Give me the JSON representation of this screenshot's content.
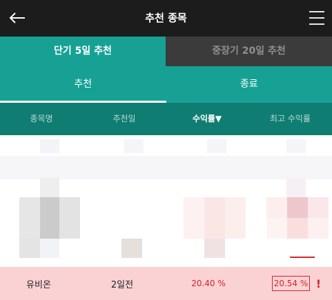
{
  "header": {
    "title": "추천 종목",
    "back_icon": "arrow-left-icon",
    "menu_icon": "hamburger-menu-icon"
  },
  "term_tabs": [
    {
      "label": "단기 5일 추천",
      "active": true
    },
    {
      "label": "중장기 20일 추천",
      "active": false
    }
  ],
  "status_tabs": [
    {
      "label": "추천",
      "active": true
    },
    {
      "label": "종료",
      "active": false
    }
  ],
  "columns": {
    "name": "종목명",
    "date": "추천일",
    "return": "수익률▼",
    "max_return": "최고 수익률"
  },
  "highlight_row": {
    "name": "유비온",
    "date": "2일전",
    "return": "20.40 %",
    "max_return": "20.54 %",
    "alert": "!"
  },
  "colors": {
    "header_bg": "#1c1c1c",
    "accent": "#17a195",
    "column_header_bg": "#0f7d72",
    "highlight_bg": "#fbd2d4",
    "positive_red": "#d6232a"
  }
}
